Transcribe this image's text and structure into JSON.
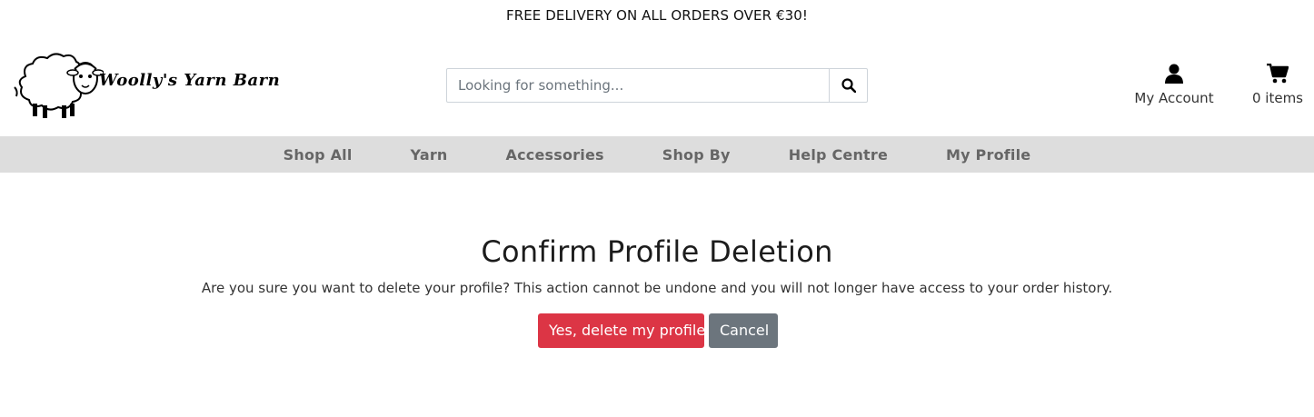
{
  "banner": {
    "text": "FREE DELIVERY ON ALL ORDERS OVER €30!"
  },
  "header": {
    "logo_text": "Woolly's Yarn Barn",
    "search": {
      "placeholder": "Looking for something..."
    },
    "account_label": "My Account",
    "cart_label": "0 items"
  },
  "nav": {
    "items": [
      "Shop All",
      "Yarn",
      "Accessories",
      "Shop By",
      "Help Centre",
      "My Profile"
    ]
  },
  "main": {
    "title": "Confirm Profile Deletion",
    "message": "Are you sure you want to delete your profile? This action cannot be undone and you will not longer have access to your order history.",
    "confirm_label": "Yes, delete my profile",
    "cancel_label": "Cancel"
  },
  "colors": {
    "nav_bg": "#dddddd",
    "danger": "#dc3545",
    "secondary": "#6c757d"
  },
  "icons": {
    "logo": "sheep-logo",
    "search": "search-icon",
    "account": "user-icon",
    "cart": "cart-icon"
  }
}
